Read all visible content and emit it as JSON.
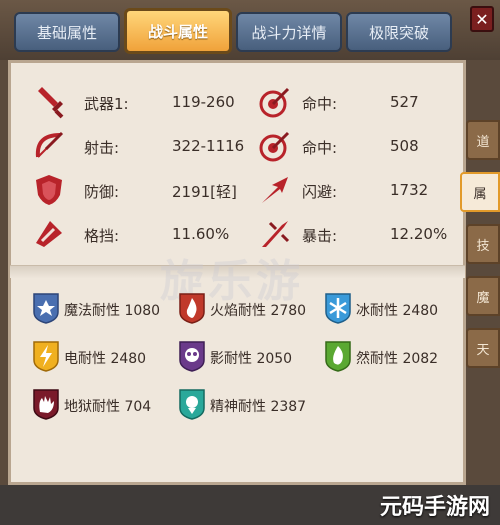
{
  "tabs": [
    "基础属性",
    "战斗属性",
    "战斗力详情",
    "极限突破"
  ],
  "active_tab": 1,
  "stats_left": [
    {
      "label": "武器1:",
      "value": "119-260",
      "icon": "sword-icon"
    },
    {
      "label": "射击:",
      "value": "322-1116",
      "icon": "bow-icon"
    },
    {
      "label": "防御:",
      "value": "2191[轻]",
      "icon": "shield-icon"
    },
    {
      "label": "格挡:",
      "value": "11.60%",
      "icon": "block-icon"
    }
  ],
  "stats_right": [
    {
      "label": "命中:",
      "value": "527",
      "icon": "target-icon"
    },
    {
      "label": "命中:",
      "value": "508",
      "icon": "target-icon"
    },
    {
      "label": "闪避:",
      "value": "1732",
      "icon": "dodge-icon"
    },
    {
      "label": "暴击:",
      "value": "12.20%",
      "icon": "crit-icon"
    }
  ],
  "resistances": [
    {
      "text": "魔法耐性 1080",
      "color": "#4a6fb0",
      "icon": "magic-star-icon"
    },
    {
      "text": "火焰耐性 2780",
      "color": "#c0392b",
      "icon": "fire-icon"
    },
    {
      "text": "冰耐性 2480",
      "color": "#3a9ad9",
      "icon": "snowflake-icon"
    },
    {
      "text": "电耐性 2480",
      "color": "#f0b020",
      "icon": "lightning-icon"
    },
    {
      "text": "影耐性 2050",
      "color": "#6a3a8a",
      "icon": "skull-icon"
    },
    {
      "text": "然耐性 2082",
      "color": "#5aa832",
      "icon": "flame-green-icon"
    },
    {
      "text": "地狱耐性 704",
      "color": "#7a1a2a",
      "icon": "hell-hand-icon"
    },
    {
      "text": "精神耐性 2387",
      "color": "#2aa89a",
      "icon": "spirit-icon"
    }
  ],
  "side_tabs": [
    "道",
    "属",
    "技",
    "魔",
    "天"
  ],
  "watermark": "旋乐游",
  "brand": "元码手游网",
  "close_label": "✕"
}
